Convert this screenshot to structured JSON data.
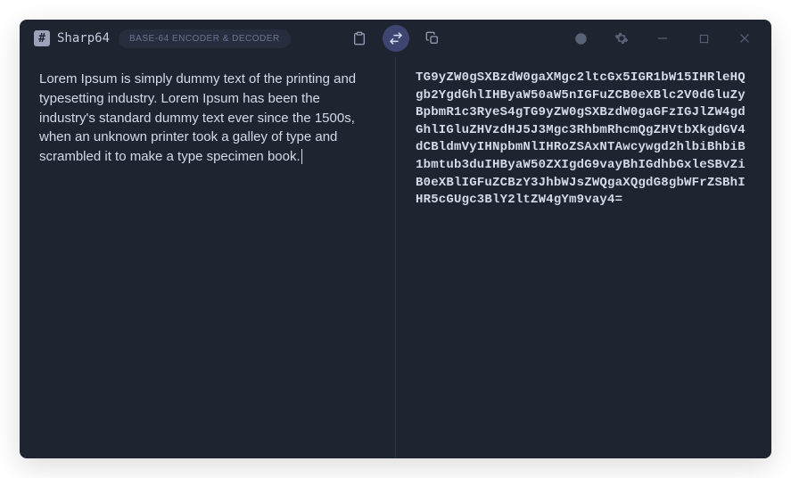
{
  "app": {
    "name": "Sharp64",
    "subtitle": "BASE-64 ENCODER & DECODER",
    "logo_glyph": "#"
  },
  "input": {
    "text": "Lorem Ipsum is simply dummy text of the printing and typesetting industry. Lorem Ipsum has been the industry's standard dummy text ever since the 1500s, when an unknown printer took a galley of type and scrambled it to make a type specimen book."
  },
  "output": {
    "text": "TG9yZW0gSXBzdW0gaXMgc2ltcGx5IGR1bW15IHRleHQgb2YgdGhlIHByaW50aW5nIGFuZCB0eXBlc2V0dGluZyBpbmR1c3RyeS4gTG9yZW0gSXBzdW0gaGFzIGJlZW4gdGhlIGluZHVzdHJ5J3Mgc3RhbmRhcmQgZHVtbXkgdGV4dCBldmVyIHNpbmNlIHRoZSAxNTAwcywgd2hlbiBhbiB1bmtub3duIHByaW50ZXIgdG9vayBhIGdhbGxleSBvZiB0eXBlIGFuZCBzY3JhbWJsZWQgaXQgdG8gbWFrZSBhIHR5cGUgc3BlY2ltZW4gYm9vay4="
  }
}
